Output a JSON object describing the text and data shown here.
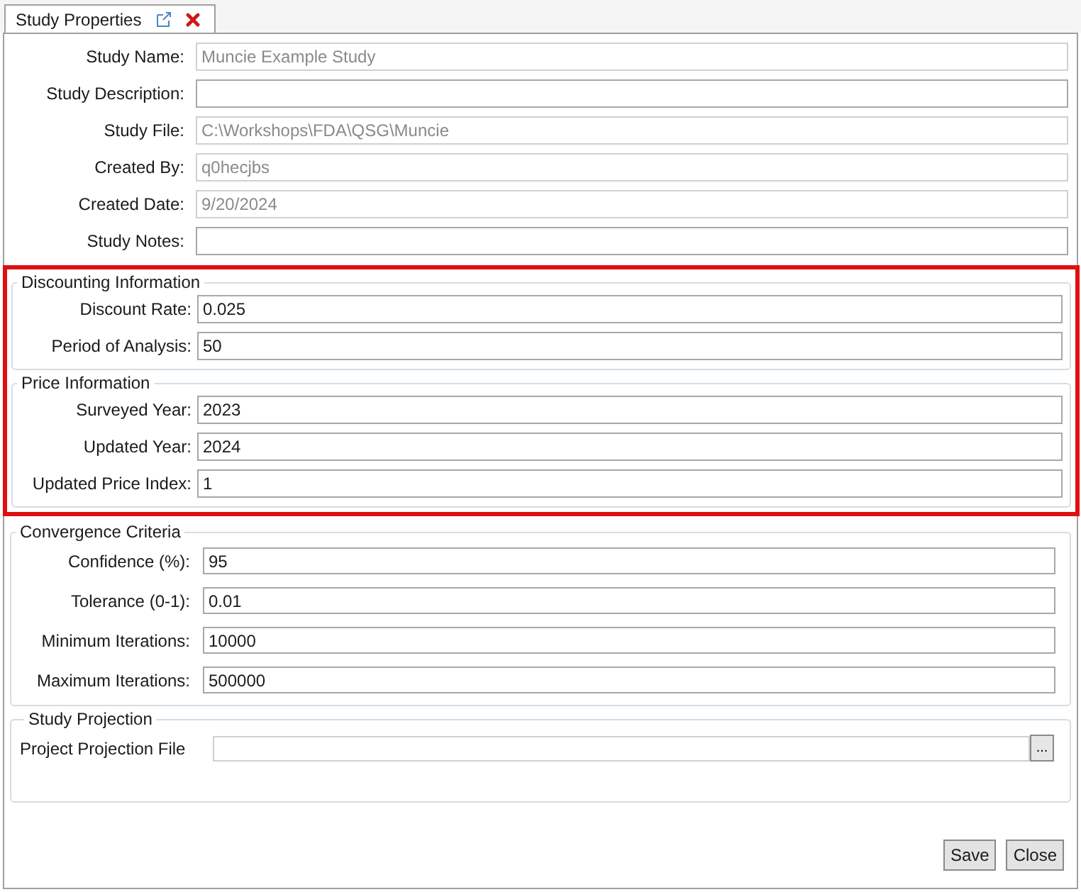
{
  "tabs": [
    {
      "label": "Study Properties",
      "selected": true
    }
  ],
  "fields": [
    {
      "label": "Study Name:",
      "value": "Muncie Example Study",
      "readonly": true
    },
    {
      "label": "Study Description:",
      "readonly": false
    },
    {
      "label": "Study File:",
      "value": "C:\\Workshops\\FDA\\QSG\\Muncie",
      "readonly": true
    },
    {
      "label": "Created By:",
      "value": "q0hecjbs",
      "readonly": true
    },
    {
      "label": "Created Date:",
      "value": "9/20/2024",
      "readonly": true
    },
    {
      "label": "Study Notes:",
      "readonly": false
    }
  ],
  "sections": [
    {
      "title": "Discounting Information",
      "highlighted": true,
      "fields": [
        {
          "label": "Discount Rate:",
          "value": "0.025"
        },
        {
          "label": "Period of Analysis:",
          "value": "50"
        }
      ]
    },
    {
      "title": "Price Information",
      "highlighted": true,
      "fields": [
        {
          "label": "Surveyed Year:",
          "value": "2023"
        },
        {
          "label": "Updated Year:",
          "value": "2024"
        },
        {
          "label": "Updated Price Index:",
          "value": "1"
        }
      ]
    },
    {
      "title": "Convergence Criteria",
      "highlighted": false,
      "fields": [
        {
          "label": "Confidence (%):",
          "value": "95"
        },
        {
          "label": "Tolerance (0-1):",
          "value": "0.01"
        },
        {
          "label": "Minimum Iterations:",
          "value": "10000"
        },
        {
          "label": "Maximum Iterations:",
          "value": "500000"
        }
      ]
    }
  ],
  "projection": {
    "title": "Study Projection",
    "label": "Project Projection File",
    "browse": "..."
  },
  "buttons": [
    "Save",
    "Close"
  ]
}
